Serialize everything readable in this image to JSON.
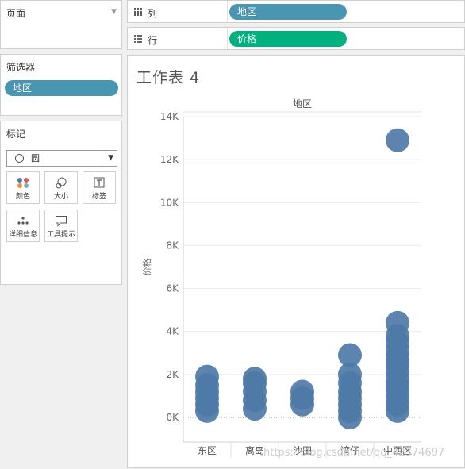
{
  "left": {
    "pages": {
      "title": "页面"
    },
    "filters": {
      "title": "筛选器",
      "pill": "地区"
    },
    "marks": {
      "title": "标记",
      "mark_type": "圆",
      "buttons": [
        {
          "label": "颜色",
          "icon": "color-dots-icon"
        },
        {
          "label": "大小",
          "icon": "size-circles-icon"
        },
        {
          "label": "标签",
          "icon": "text-label-icon"
        },
        {
          "label": "详细信息",
          "icon": "detail-dots-icon"
        },
        {
          "label": "工具提示",
          "icon": "tooltip-bubble-icon"
        }
      ]
    }
  },
  "shelves": {
    "columns": {
      "label": "列",
      "pill": "地区",
      "pill_color": "#4996b2",
      "icon": "columns-icon"
    },
    "rows": {
      "label": "行",
      "pill": "价格",
      "pill_color": "#00b180",
      "icon": "rows-icon"
    }
  },
  "sheet": {
    "title": "工作表 4"
  },
  "chart_data": {
    "type": "scatter",
    "mark": "circle",
    "title": "",
    "header": "地区",
    "xlabel": "",
    "ylabel": "价格",
    "categories": [
      "东区",
      "离岛",
      "沙田",
      "湾仔",
      "中西区"
    ],
    "ylim": [
      0,
      14000
    ],
    "yticks": [
      0,
      2000,
      4000,
      6000,
      8000,
      10000,
      12000,
      14000
    ],
    "ytick_labels": [
      "0K",
      "2K",
      "4K",
      "6K",
      "8K",
      "10K",
      "12K",
      "14K"
    ],
    "color": "#4e79a7",
    "grid": true,
    "series": [
      {
        "category": "东区",
        "values": [
          300,
          600,
          900,
          1200,
          1500,
          1900
        ]
      },
      {
        "category": "离岛",
        "values": [
          400,
          800,
          1200,
          1600,
          1800
        ]
      },
      {
        "category": "沙田",
        "values": [
          600,
          900,
          1200
        ]
      },
      {
        "category": "湾仔",
        "values": [
          0,
          300,
          600,
          900,
          1200,
          1600,
          2000,
          2900
        ]
      },
      {
        "category": "中西区",
        "values": [
          300,
          600,
          900,
          1200,
          1500,
          1800,
          2200,
          2500,
          2800,
          3100,
          3500,
          3800,
          4400,
          12900
        ]
      }
    ]
  },
  "watermark": "https://blog.csdn.net/qq_42374697"
}
